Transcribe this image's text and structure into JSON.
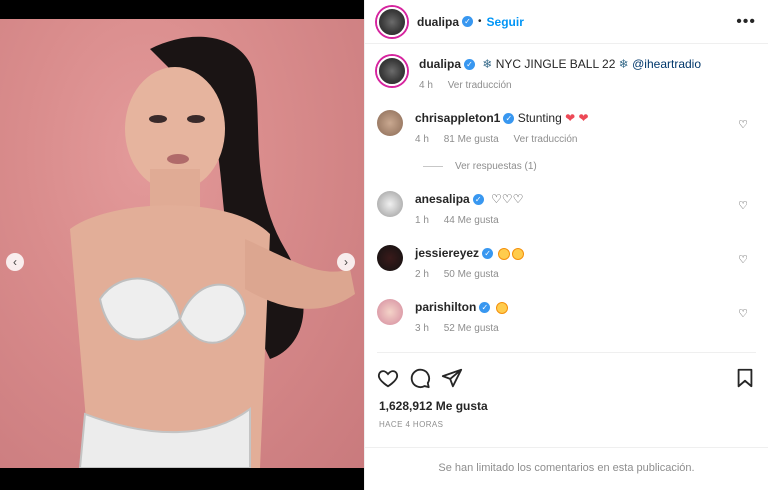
{
  "post": {
    "username": "dualipa",
    "follow_label": "Seguir",
    "dot": "•",
    "more": "•••"
  },
  "caption": {
    "username": "dualipa",
    "text": "NYC JINGLE BALL 22",
    "mention": "@iheartradio",
    "time": "4 h",
    "translate": "Ver traducción"
  },
  "comments": [
    {
      "username": "chrisappleton1",
      "text": "Stunting",
      "emoji": "❤ ❤",
      "time": "4 h",
      "likes": "81 Me gusta",
      "translate": "Ver traducción"
    },
    {
      "username": "anesalipa",
      "text": "",
      "emoji": "♡♡♡",
      "time": "1 h",
      "likes": "44 Me gusta"
    },
    {
      "username": "jessiereyez",
      "text": "",
      "emoji": "",
      "time": "2 h",
      "likes": "50 Me gusta"
    },
    {
      "username": "parishilton",
      "text": "",
      "emoji": "",
      "time": "3 h",
      "likes": "52 Me gusta"
    }
  ],
  "replies_label": "Ver respuestas (1)",
  "likes_count": "1,628,912 Me gusta",
  "posted_time": "HACE 4 HORAS",
  "comments_limited": "Se han limitado los comentarios en esta publicación.",
  "icons": {
    "like": "heart-outline-icon",
    "comment": "comment-bubble-icon",
    "share": "paper-plane-icon",
    "save": "bookmark-icon",
    "verified": "verified-badge-icon",
    "snowflake": "snowflake-icon"
  },
  "colors": {
    "accent": "#0095f6",
    "verified": "#3897f0",
    "muted": "#8e8e8e",
    "media_bg": "#d98c8c"
  }
}
